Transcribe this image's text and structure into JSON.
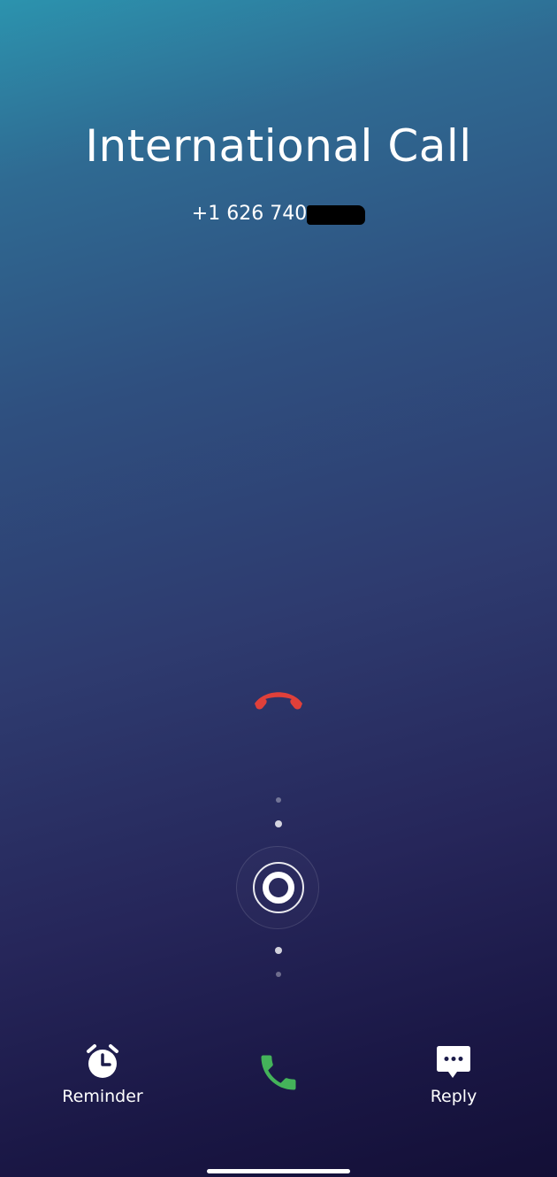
{
  "call": {
    "title": "International Call",
    "number": "+1 626 740"
  },
  "actions": {
    "reminder_label": "Reminder",
    "reply_label": "Reply"
  },
  "icons": {
    "decline": "phone-hangup-icon",
    "answer": "phone-icon",
    "reminder": "alarm-clock-icon",
    "reply": "message-bubble-icon"
  },
  "colors": {
    "decline": "#e0403a",
    "answer": "#44b35a"
  }
}
